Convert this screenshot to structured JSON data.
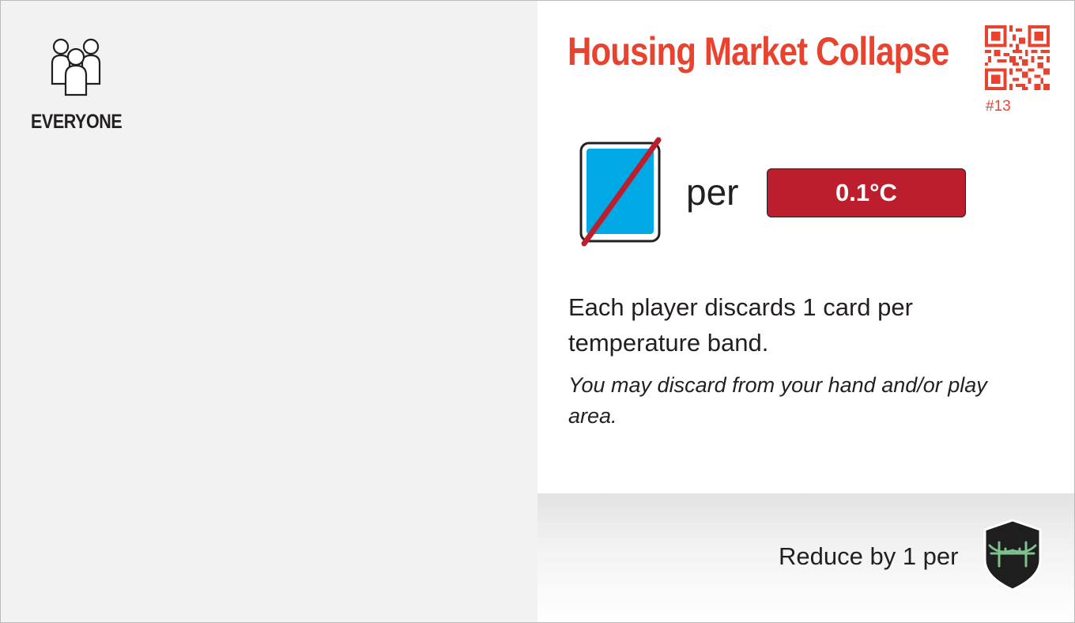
{
  "target": {
    "icon": "everyone-icon",
    "label": "EVERYONE"
  },
  "card": {
    "title": "Housing Market Collapse",
    "number": "#13",
    "qr_icon": "qr-code-icon",
    "title_color": "#e8432f"
  },
  "effect": {
    "icon": "discard-card-icon",
    "per_label": "per",
    "temperature": "0.1°C",
    "badge_color": "#bd1e2d",
    "rule": "Each player discards 1 card per temperature band.",
    "note": "You may discard from your hand and/or play area."
  },
  "mitigation": {
    "text": "Reduce by 1 per",
    "icon": "bridge-shield-icon"
  }
}
